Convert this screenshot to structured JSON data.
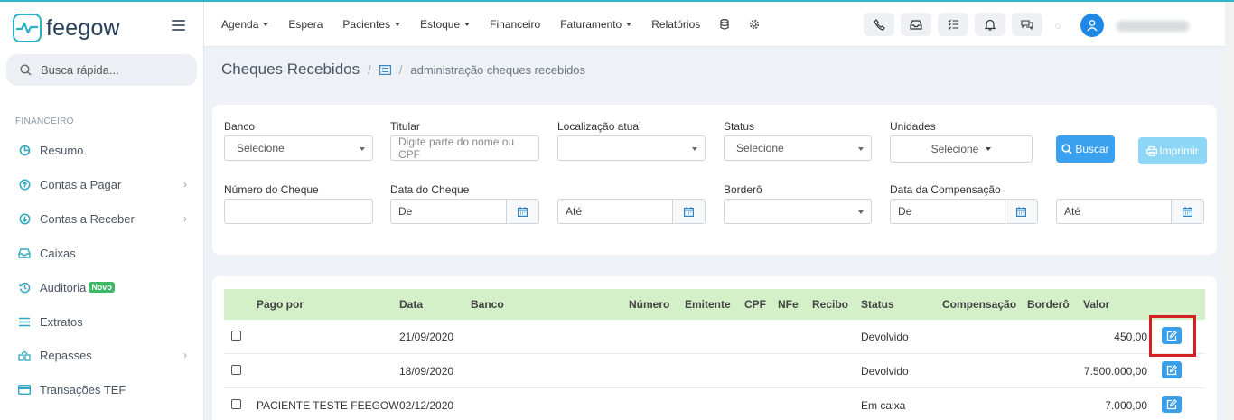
{
  "brand": {
    "name": "feegow",
    "accent": "#27b3c4"
  },
  "search": {
    "label": "Busca rápida..."
  },
  "sidebar": {
    "section": "FINANCEIRO",
    "items": [
      {
        "label": "Resumo",
        "icon": "pie-chart-icon",
        "chevron": false
      },
      {
        "label": "Contas a Pagar",
        "icon": "arrow-up-circle-icon",
        "chevron": true
      },
      {
        "label": "Contas a Receber",
        "icon": "arrow-down-circle-icon",
        "chevron": true
      },
      {
        "label": "Caixas",
        "icon": "inbox-icon",
        "chevron": false
      },
      {
        "label": "Auditoria",
        "icon": "history-icon",
        "chevron": false,
        "badge": "Novo"
      },
      {
        "label": "Extratos",
        "icon": "list-icon",
        "chevron": false
      },
      {
        "label": "Repasses",
        "icon": "share-icon",
        "chevron": true
      },
      {
        "label": "Transações TEF",
        "icon": "card-icon",
        "chevron": false
      }
    ]
  },
  "topmenu": [
    {
      "label": "Agenda",
      "caret": true
    },
    {
      "label": "Espera",
      "caret": false
    },
    {
      "label": "Pacientes",
      "caret": true
    },
    {
      "label": "Estoque",
      "caret": true
    },
    {
      "label": "Financeiro",
      "caret": false
    },
    {
      "label": "Faturamento",
      "caret": true
    },
    {
      "label": "Relatórios",
      "caret": false
    }
  ],
  "breadcrumb": {
    "title": "Cheques Recebidos",
    "sub": "administração cheques recebidos"
  },
  "filters": {
    "banco": {
      "label": "Banco",
      "value": "Selecione"
    },
    "titular": {
      "label": "Titular",
      "placeholder": "Digite parte do nome ou CPF"
    },
    "localizacao": {
      "label": "Localização atual",
      "value": ""
    },
    "status": {
      "label": "Status",
      "value": "Selecione"
    },
    "unidades": {
      "label": "Unidades",
      "value": "Selecione"
    },
    "numero": {
      "label": "Número do Cheque",
      "value": ""
    },
    "data_cheque": {
      "label": "Data do Cheque",
      "de": "De",
      "ate": "Até"
    },
    "bordero": {
      "label": "Borderô",
      "value": ""
    },
    "data_comp": {
      "label": "Data da Compensação",
      "de": "De",
      "ate": "Até"
    },
    "buscar": "Buscar",
    "imprimir": "Imprimir"
  },
  "table": {
    "headers": {
      "pago_por": "Pago por",
      "data": "Data",
      "banco": "Banco",
      "numero": "Número",
      "emitente": "Emitente",
      "cpf": "CPF",
      "nfe": "NFe",
      "recibo": "Recibo",
      "status": "Status",
      "compensacao": "Compensação",
      "bordero": "Borderô",
      "valor": "Valor"
    },
    "rows": [
      {
        "pago_por": "",
        "data": "21/09/2020",
        "status": "Devolvido",
        "valor": "450,00"
      },
      {
        "pago_por": "",
        "data": "18/09/2020",
        "status": "Devolvido",
        "valor": "7.500.000,00"
      },
      {
        "pago_por": "PACIENTE TESTE FEEGOW",
        "data": "02/12/2020",
        "status": "Em caixa",
        "valor": "7.000,00"
      }
    ]
  }
}
